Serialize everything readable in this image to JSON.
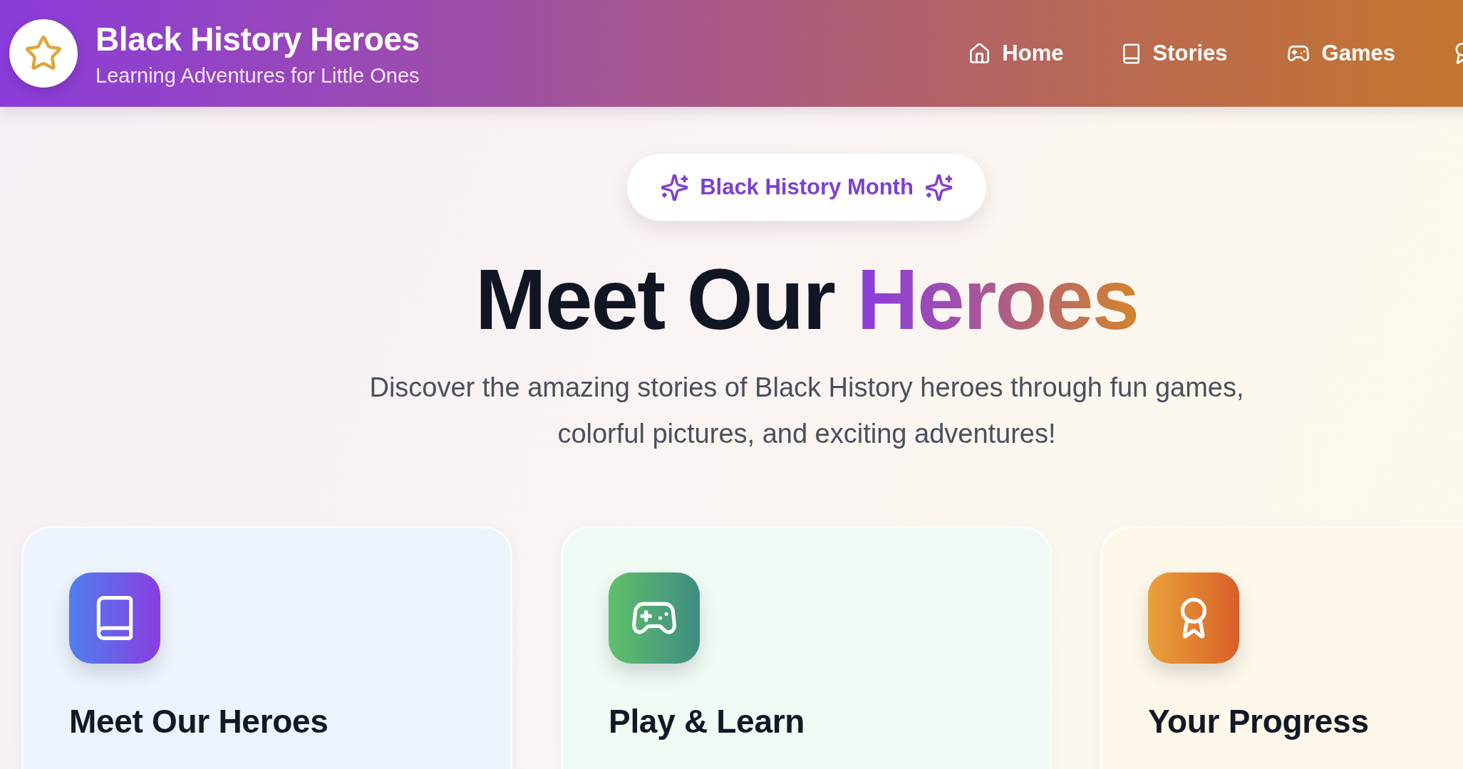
{
  "header": {
    "title": "Black History Heroes",
    "subtitle": "Learning Adventures for Little Ones"
  },
  "nav": {
    "items": [
      {
        "label": "Home"
      },
      {
        "label": "Stories"
      },
      {
        "label": "Games"
      }
    ]
  },
  "hero": {
    "badge": "Black History Month",
    "title": "Meet Our",
    "title_highlight": "Heroes",
    "description": "Discover the amazing stories of Black History heroes through fun games, colorful pictures, and exciting adventures!"
  },
  "features": [
    {
      "title": "Meet Our Heroes"
    },
    {
      "title": "Play & Learn"
    },
    {
      "title": "Your Progress"
    }
  ]
}
